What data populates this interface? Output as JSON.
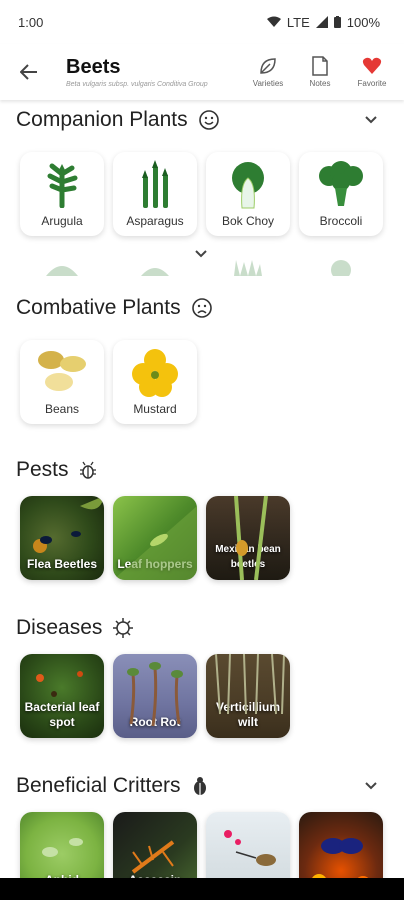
{
  "status": {
    "time": "1:00",
    "network": "LTE",
    "battery": "100%"
  },
  "header": {
    "title": "Beets",
    "subtitle": "Beta vulgaris subsp. vulgaris Conditiva Group",
    "actions": [
      {
        "label": "Varieties",
        "icon": "leaf-icon"
      },
      {
        "label": "Notes",
        "icon": "note-icon"
      },
      {
        "label": "Favorite",
        "icon": "heart-icon",
        "color": "#e53935"
      }
    ]
  },
  "companion": {
    "title": "Companion Plants",
    "items": [
      {
        "label": "Arugula",
        "icon": "arugula-icon"
      },
      {
        "label": "Asparagus",
        "icon": "asparagus-icon"
      },
      {
        "label": "Bok Choy",
        "icon": "bok-choy-icon"
      },
      {
        "label": "Broccoli",
        "icon": "broccoli-icon"
      }
    ]
  },
  "combative": {
    "title": "Combative Plants",
    "items": [
      {
        "label": "Beans",
        "icon": "beans-icon"
      },
      {
        "label": "Mustard",
        "icon": "mustard-icon"
      }
    ]
  },
  "pests": {
    "title": "Pests",
    "items": [
      {
        "label": "Flea Beetles"
      },
      {
        "label": "Leaf hoppers"
      },
      {
        "label": "Mexican bean beetles"
      }
    ]
  },
  "diseases": {
    "title": "Diseases",
    "items": [
      {
        "label": "Bacterial leaf spot"
      },
      {
        "label": "Root Rot"
      },
      {
        "label": "Verticillium wilt"
      }
    ]
  },
  "critters": {
    "title": "Beneficial Critters",
    "items": [
      {
        "label": "Aphid"
      },
      {
        "label": "Assassin"
      },
      {
        "label": ""
      },
      {
        "label": ""
      }
    ]
  },
  "colors": {
    "accent_green": "#2e7d32",
    "heart": "#e53935",
    "mustard": "#f4c20d"
  }
}
